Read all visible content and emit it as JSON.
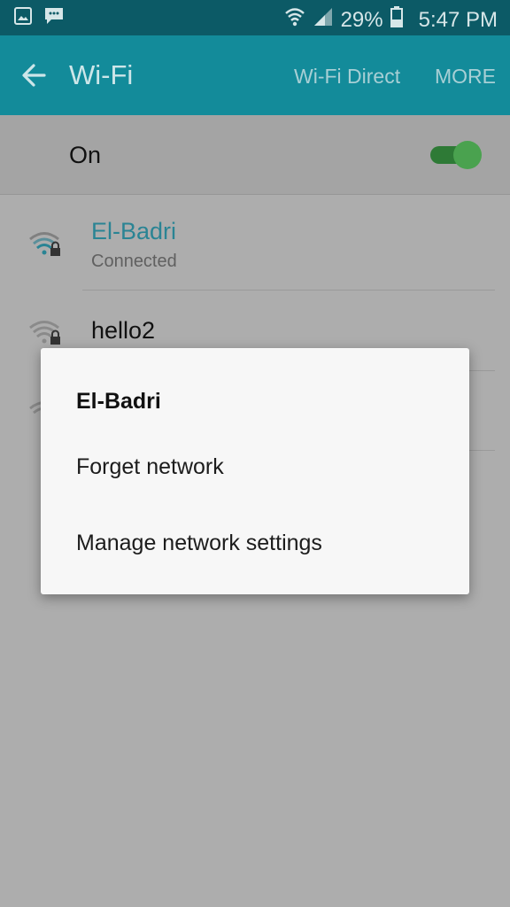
{
  "status_bar": {
    "icons_left": [
      "image-icon",
      "bbm-icon"
    ],
    "battery_percent": "29%",
    "time": "5:47 PM"
  },
  "app_bar": {
    "title": "Wi-Fi",
    "wifi_direct": "Wi-Fi Direct",
    "more": "MORE"
  },
  "wifi_toggle": {
    "label": "On",
    "state": true
  },
  "networks": [
    {
      "name": "El-Badri",
      "status": "Connected",
      "secured": true,
      "color": "#2a8494"
    },
    {
      "name": "hello2",
      "secured": true
    }
  ],
  "dialog": {
    "title": "El-Badri",
    "items": [
      "Forget network",
      "Manage network settings"
    ]
  },
  "colors": {
    "status_bar": "#0c5a66",
    "app_bar": "#138b9a",
    "toggle": "#4aa24f"
  }
}
